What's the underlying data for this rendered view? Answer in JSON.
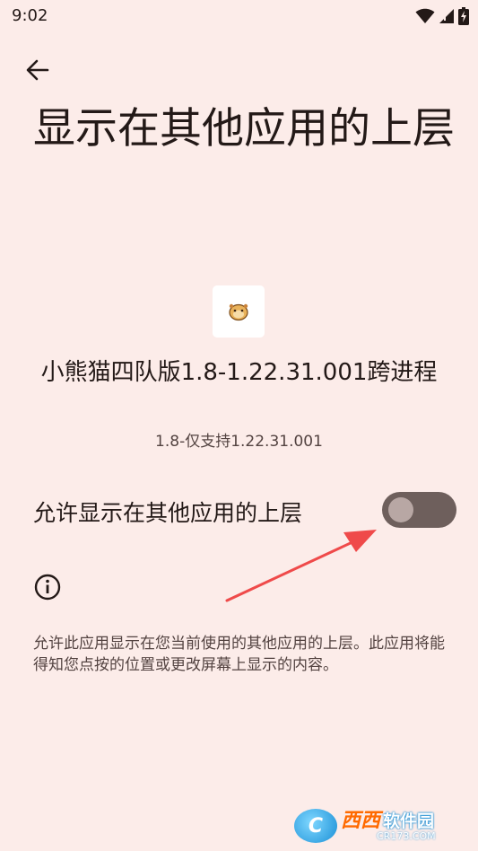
{
  "status_bar": {
    "time": "9:02",
    "icons": [
      "wifi-icon",
      "signal-icon",
      "battery-charging-icon"
    ]
  },
  "header": {
    "back_icon": "arrow-left-icon",
    "title": "显示在其他应用的上层"
  },
  "app": {
    "icon": "panda-app-icon",
    "name": "小熊猫四队版1.8-1.22.31.001跨进程",
    "version": "1.8-仅支持1.22.31.001"
  },
  "permission": {
    "label": "允许显示在其他应用的上层",
    "enabled": false
  },
  "info": {
    "icon": "info-icon",
    "description": "允许此应用显示在您当前使用的其他应用的上层。此应用将能得知您点按的位置或更改屏幕上显示的内容。"
  },
  "watermark": {
    "logo_letter": "C",
    "brand_a": "西西",
    "brand_b": "软件园",
    "site": "CR173.COM"
  },
  "colors": {
    "background": "#fcece9",
    "switch_track": "#6e5f5c",
    "switch_knob": "#b8a7a4",
    "annotation_arrow": "#ef4a4a"
  }
}
